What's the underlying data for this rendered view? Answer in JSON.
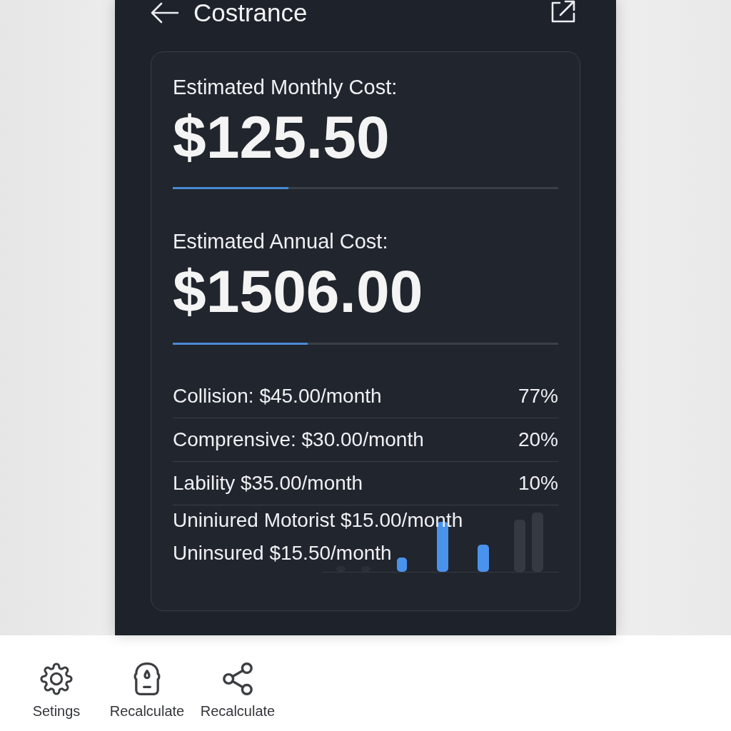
{
  "header": {
    "title": "Costrance"
  },
  "summary": [
    {
      "label": "Estimated Monthly Cost:",
      "amount": "$125.50",
      "level": 0.3
    },
    {
      "label": "Estimated Annual Cost:",
      "amount": "$1506.00",
      "level": 0.35
    }
  ],
  "breakdown": {
    "rows": [
      {
        "label": "Collision: $45.00/month",
        "percent": "77%"
      },
      {
        "label": "Comprensive: $30.00/month",
        "percent": "20%"
      },
      {
        "label": "Lability $35.00/month",
        "percent": "10%"
      }
    ],
    "extra_lines": [
      "Uniniured Motorist $15.00/month",
      "Uninsured $15.50/month"
    ]
  },
  "bottom_nav": [
    {
      "kind": "settings",
      "label": "Setings"
    },
    {
      "kind": "recalculate",
      "label": "Recalculate"
    },
    {
      "kind": "share",
      "label": "Recalculate"
    }
  ]
}
